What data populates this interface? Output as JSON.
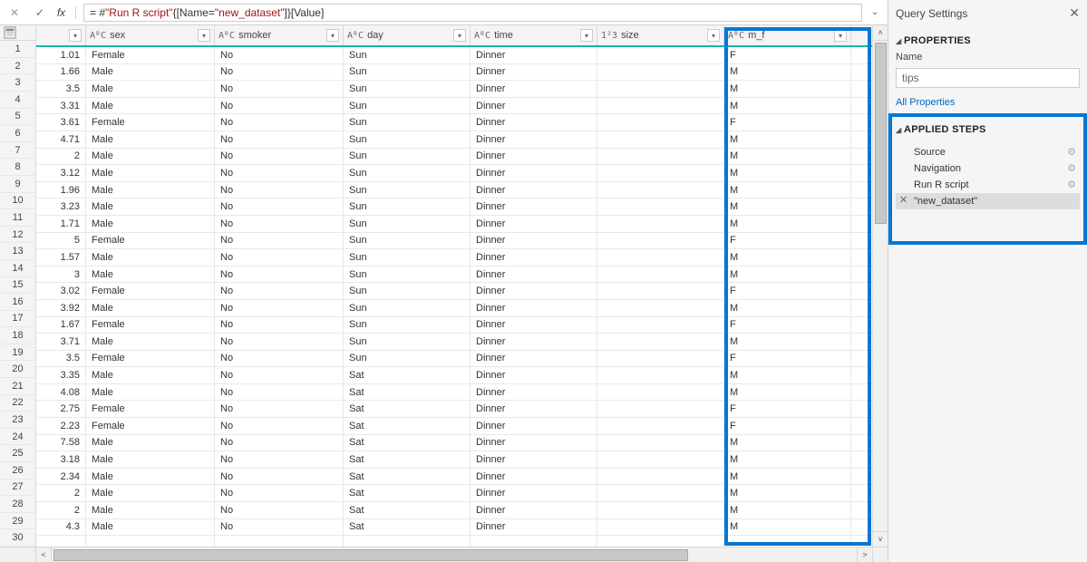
{
  "formula_bar": {
    "prefix": "= #",
    "q1": "\"Run R script\"",
    "mid": "{[Name=",
    "q2": "\"new_dataset\"",
    "suffix": "]}[Value]"
  },
  "columns": [
    {
      "type": "",
      "label": ""
    },
    {
      "type": "AᴮC",
      "label": "sex"
    },
    {
      "type": "AᴮC",
      "label": "smoker"
    },
    {
      "type": "AᴮC",
      "label": "day"
    },
    {
      "type": "AᴮC",
      "label": "time"
    },
    {
      "type": "1²3",
      "label": "size"
    },
    {
      "type": "AᴮC",
      "label": "m_f"
    }
  ],
  "rows": [
    {
      "n": 1,
      "tip": 1.01,
      "sex": "Female",
      "smoker": "No",
      "day": "Sun",
      "time": "Dinner",
      "size": "",
      "mf": "F"
    },
    {
      "n": 2,
      "tip": 1.66,
      "sex": "Male",
      "smoker": "No",
      "day": "Sun",
      "time": "Dinner",
      "size": "",
      "mf": "M"
    },
    {
      "n": 3,
      "tip": 3.5,
      "sex": "Male",
      "smoker": "No",
      "day": "Sun",
      "time": "Dinner",
      "size": "",
      "mf": "M"
    },
    {
      "n": 4,
      "tip": 3.31,
      "sex": "Male",
      "smoker": "No",
      "day": "Sun",
      "time": "Dinner",
      "size": "",
      "mf": "M"
    },
    {
      "n": 5,
      "tip": 3.61,
      "sex": "Female",
      "smoker": "No",
      "day": "Sun",
      "time": "Dinner",
      "size": "",
      "mf": "F"
    },
    {
      "n": 6,
      "tip": 4.71,
      "sex": "Male",
      "smoker": "No",
      "day": "Sun",
      "time": "Dinner",
      "size": "",
      "mf": "M"
    },
    {
      "n": 7,
      "tip": 2,
      "sex": "Male",
      "smoker": "No",
      "day": "Sun",
      "time": "Dinner",
      "size": "",
      "mf": "M"
    },
    {
      "n": 8,
      "tip": 3.12,
      "sex": "Male",
      "smoker": "No",
      "day": "Sun",
      "time": "Dinner",
      "size": "",
      "mf": "M"
    },
    {
      "n": 9,
      "tip": 1.96,
      "sex": "Male",
      "smoker": "No",
      "day": "Sun",
      "time": "Dinner",
      "size": "",
      "mf": "M"
    },
    {
      "n": 10,
      "tip": 3.23,
      "sex": "Male",
      "smoker": "No",
      "day": "Sun",
      "time": "Dinner",
      "size": "",
      "mf": "M"
    },
    {
      "n": 11,
      "tip": 1.71,
      "sex": "Male",
      "smoker": "No",
      "day": "Sun",
      "time": "Dinner",
      "size": "",
      "mf": "M"
    },
    {
      "n": 12,
      "tip": 5,
      "sex": "Female",
      "smoker": "No",
      "day": "Sun",
      "time": "Dinner",
      "size": "",
      "mf": "F"
    },
    {
      "n": 13,
      "tip": 1.57,
      "sex": "Male",
      "smoker": "No",
      "day": "Sun",
      "time": "Dinner",
      "size": "",
      "mf": "M"
    },
    {
      "n": 14,
      "tip": 3,
      "sex": "Male",
      "smoker": "No",
      "day": "Sun",
      "time": "Dinner",
      "size": "",
      "mf": "M"
    },
    {
      "n": 15,
      "tip": 3.02,
      "sex": "Female",
      "smoker": "No",
      "day": "Sun",
      "time": "Dinner",
      "size": "",
      "mf": "F"
    },
    {
      "n": 16,
      "tip": 3.92,
      "sex": "Male",
      "smoker": "No",
      "day": "Sun",
      "time": "Dinner",
      "size": "",
      "mf": "M"
    },
    {
      "n": 17,
      "tip": 1.67,
      "sex": "Female",
      "smoker": "No",
      "day": "Sun",
      "time": "Dinner",
      "size": "",
      "mf": "F"
    },
    {
      "n": 18,
      "tip": 3.71,
      "sex": "Male",
      "smoker": "No",
      "day": "Sun",
      "time": "Dinner",
      "size": "",
      "mf": "M"
    },
    {
      "n": 19,
      "tip": 3.5,
      "sex": "Female",
      "smoker": "No",
      "day": "Sun",
      "time": "Dinner",
      "size": "",
      "mf": "F"
    },
    {
      "n": 20,
      "tip": 3.35,
      "sex": "Male",
      "smoker": "No",
      "day": "Sat",
      "time": "Dinner",
      "size": "",
      "mf": "M"
    },
    {
      "n": 21,
      "tip": 4.08,
      "sex": "Male",
      "smoker": "No",
      "day": "Sat",
      "time": "Dinner",
      "size": "",
      "mf": "M"
    },
    {
      "n": 22,
      "tip": 2.75,
      "sex": "Female",
      "smoker": "No",
      "day": "Sat",
      "time": "Dinner",
      "size": "",
      "mf": "F"
    },
    {
      "n": 23,
      "tip": 2.23,
      "sex": "Female",
      "smoker": "No",
      "day": "Sat",
      "time": "Dinner",
      "size": "",
      "mf": "F"
    },
    {
      "n": 24,
      "tip": 7.58,
      "sex": "Male",
      "smoker": "No",
      "day": "Sat",
      "time": "Dinner",
      "size": "",
      "mf": "M"
    },
    {
      "n": 25,
      "tip": 3.18,
      "sex": "Male",
      "smoker": "No",
      "day": "Sat",
      "time": "Dinner",
      "size": "",
      "mf": "M"
    },
    {
      "n": 26,
      "tip": 2.34,
      "sex": "Male",
      "smoker": "No",
      "day": "Sat",
      "time": "Dinner",
      "size": "",
      "mf": "M"
    },
    {
      "n": 27,
      "tip": 2,
      "sex": "Male",
      "smoker": "No",
      "day": "Sat",
      "time": "Dinner",
      "size": "",
      "mf": "M"
    },
    {
      "n": 28,
      "tip": 2,
      "sex": "Male",
      "smoker": "No",
      "day": "Sat",
      "time": "Dinner",
      "size": "",
      "mf": "M"
    },
    {
      "n": 29,
      "tip": 4.3,
      "sex": "Male",
      "smoker": "No",
      "day": "Sat",
      "time": "Dinner",
      "size": "",
      "mf": "M"
    },
    {
      "n": 30,
      "tip": "",
      "sex": "",
      "smoker": "",
      "day": "",
      "time": "",
      "size": "",
      "mf": ""
    }
  ],
  "side": {
    "title": "Query Settings",
    "properties_head": "PROPERTIES",
    "name_label": "Name",
    "name_value": "tips",
    "all_properties": "All Properties",
    "applied_steps_head": "APPLIED STEPS",
    "steps": [
      {
        "label": "Source",
        "gear": true
      },
      {
        "label": "Navigation",
        "gear": true
      },
      {
        "label": "Run R script",
        "gear": true
      },
      {
        "label": "\"new_dataset\"",
        "selected": true
      }
    ]
  }
}
